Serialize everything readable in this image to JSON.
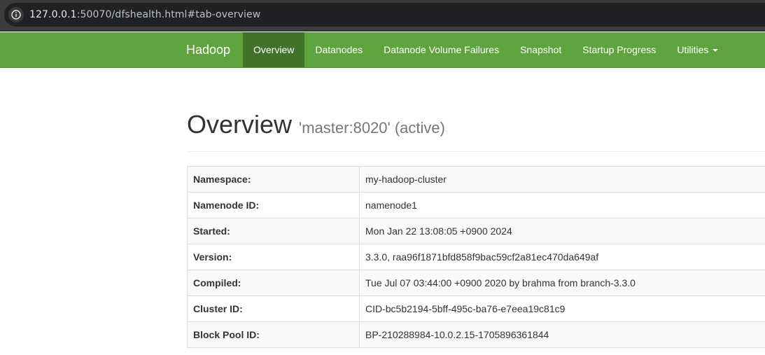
{
  "browser": {
    "url_host": "127.0.0.1",
    "url_path": ":50070/dfshealth.html#tab-overview",
    "info_icon": "info-icon"
  },
  "navbar": {
    "brand": "Hadoop",
    "items": [
      {
        "label": "Overview",
        "active": true
      },
      {
        "label": "Datanodes"
      },
      {
        "label": "Datanode Volume Failures"
      },
      {
        "label": "Snapshot"
      },
      {
        "label": "Startup Progress"
      },
      {
        "label": "Utilities",
        "dropdown": true
      }
    ],
    "colors": {
      "background": "#5fa33e",
      "active": "#41722c"
    }
  },
  "header": {
    "title": "Overview",
    "subtitle": "'master:8020' (active)"
  },
  "overview": {
    "rows": [
      {
        "key": "Namespace:",
        "value": "my-hadoop-cluster"
      },
      {
        "key": "Namenode ID:",
        "value": "namenode1"
      },
      {
        "key": "Started:",
        "value": "Mon Jan 22 13:08:05 +0900 2024"
      },
      {
        "key": "Version:",
        "value": "3.3.0, raa96f1871bfd858f9bac59cf2a81ec470da649af"
      },
      {
        "key": "Compiled:",
        "value": "Tue Jul 07 03:44:00 +0900 2020 by brahma from branch-3.3.0"
      },
      {
        "key": "Cluster ID:",
        "value": "CID-bc5b2194-5bff-495c-ba76-e7eea19c81c9"
      },
      {
        "key": "Block Pool ID:",
        "value": "BP-210288984-10.0.2.15-1705896361844"
      }
    ]
  }
}
